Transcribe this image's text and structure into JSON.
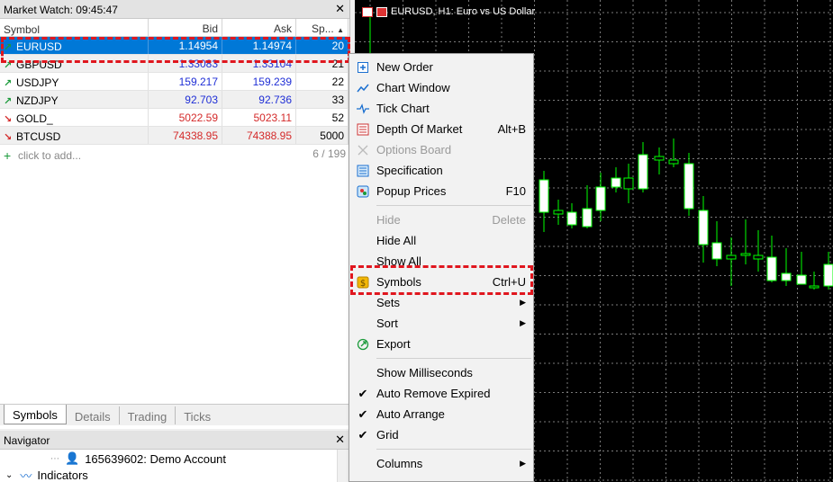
{
  "market_watch": {
    "title": "Market Watch: 09:45:47",
    "columns": [
      "Symbol",
      "Bid",
      "Ask",
      "Sp..."
    ],
    "rows": [
      {
        "symbol": "EURUSD",
        "bid": "1.14954",
        "ask": "1.14974",
        "spread": "20",
        "dir": "up"
      },
      {
        "symbol": "GBPUSD",
        "bid": "1.33083",
        "ask": "1.33104",
        "spread": "21",
        "dir": "up"
      },
      {
        "symbol": "USDJPY",
        "bid": "159.217",
        "ask": "159.239",
        "spread": "22",
        "dir": "up"
      },
      {
        "symbol": "NZDJPY",
        "bid": "92.703",
        "ask": "92.736",
        "spread": "33",
        "dir": "up"
      },
      {
        "symbol": "GOLD_",
        "bid": "5022.59",
        "ask": "5023.11",
        "spread": "52",
        "dir": "down"
      },
      {
        "symbol": "BTCUSD",
        "bid": "74338.95",
        "ask": "74388.95",
        "spread": "5000",
        "dir": "down"
      }
    ],
    "add_label": "click to add...",
    "count": "6 / 199",
    "tabs": [
      "Symbols",
      "Details",
      "Trading",
      "Ticks"
    ]
  },
  "navigator": {
    "title": "Navigator",
    "account": "165639602: Demo Account",
    "indicators": "Indicators"
  },
  "chart": {
    "title": "EURUSD, H1:  Euro vs US Dollar"
  },
  "menu": {
    "items": [
      {
        "label": "New Order",
        "shortcut": "",
        "icon": "new-order-icon"
      },
      {
        "label": "Chart Window",
        "shortcut": "",
        "icon": "chart-window-icon"
      },
      {
        "label": "Tick Chart",
        "shortcut": "",
        "icon": "tick-chart-icon"
      },
      {
        "label": "Depth Of Market",
        "shortcut": "Alt+B",
        "icon": "depth-of-market-icon"
      },
      {
        "label": "Options Board",
        "shortcut": "",
        "icon": "options-board-icon"
      },
      {
        "label": "Specification",
        "shortcut": "",
        "icon": "specification-icon"
      },
      {
        "label": "Popup Prices",
        "shortcut": "F10",
        "icon": "popup-prices-icon"
      },
      {
        "label": "Hide",
        "shortcut": "Delete"
      },
      {
        "label": "Hide All",
        "shortcut": ""
      },
      {
        "label": "Show All",
        "shortcut": ""
      },
      {
        "label": "Symbols",
        "shortcut": "Ctrl+U",
        "icon": "symbols-icon"
      },
      {
        "label": "Sets",
        "shortcut": ""
      },
      {
        "label": "Sort",
        "shortcut": ""
      },
      {
        "label": "Export",
        "shortcut": "",
        "icon": "export-icon"
      },
      {
        "label": "Show Milliseconds",
        "shortcut": ""
      },
      {
        "label": "Auto Remove Expired",
        "shortcut": ""
      },
      {
        "label": "Auto Arrange",
        "shortcut": ""
      },
      {
        "label": "Grid",
        "shortcut": ""
      },
      {
        "label": "Columns",
        "shortcut": ""
      }
    ]
  },
  "colors": {
    "selection": "#0078d7",
    "bid_ask_blue": "#1f2ed6",
    "bid_ask_red": "#d42a2a",
    "up_arrow": "#1a9a3a",
    "candle_up": "#ffffff",
    "candle_wick": "#00ff00",
    "highlight": "#e0161e"
  }
}
